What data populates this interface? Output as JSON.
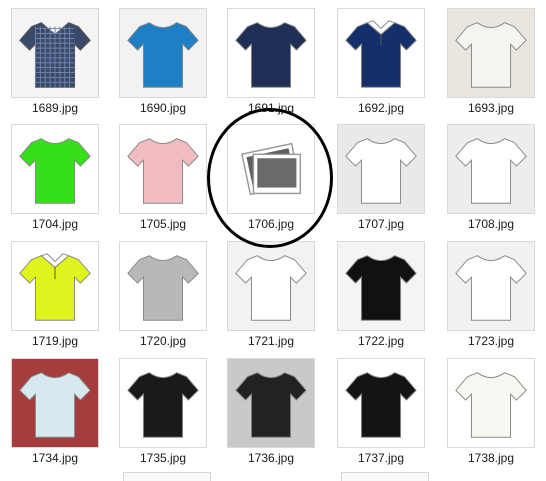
{
  "files": [
    {
      "label": "1689.jpg",
      "icon": "plaid-shirt-icon",
      "color": "#3b4a6b",
      "bg": "#f4f4f4"
    },
    {
      "label": "1690.jpg",
      "icon": "tshirt-icon",
      "color": "#1e7fc4",
      "bg": "#f2f2f2"
    },
    {
      "label": "1691.jpg",
      "icon": "tshirt-icon",
      "color": "#1f2f55",
      "bg": "#ffffff"
    },
    {
      "label": "1692.jpg",
      "icon": "polo-icon",
      "color": "#13306b",
      "bg": "#ffffff"
    },
    {
      "label": "1693.jpg",
      "icon": "tshirt-icon",
      "color": "#f5f5f0",
      "bg": "#e9e6df"
    },
    {
      "label": "1704.jpg",
      "icon": "tshirt-icon",
      "color": "#35e01a",
      "bg": "#ffffff"
    },
    {
      "label": "1705.jpg",
      "icon": "tshirt-icon",
      "color": "#f1bcc0",
      "bg": "#ffffff"
    },
    {
      "label": "1706.jpg",
      "icon": "image-placeholder-icon",
      "color": "#777777",
      "bg": "#ffffff"
    },
    {
      "label": "1707.jpg",
      "icon": "tshirt-icon",
      "color": "#ffffff",
      "bg": "#e9e9e9"
    },
    {
      "label": "1708.jpg",
      "icon": "tshirt-icon",
      "color": "#ffffff",
      "bg": "#ededed"
    },
    {
      "label": "1719.jpg",
      "icon": "polo-icon",
      "color": "#dff31c",
      "bg": "#ffffff"
    },
    {
      "label": "1720.jpg",
      "icon": "tshirt-icon",
      "color": "#b8b8b8",
      "bg": "#ffffff"
    },
    {
      "label": "1721.jpg",
      "icon": "tshirt-icon",
      "color": "#ffffff",
      "bg": "#f2f2f2"
    },
    {
      "label": "1722.jpg",
      "icon": "tshirt-icon",
      "color": "#111111",
      "bg": "#f4f4f4"
    },
    {
      "label": "1723.jpg",
      "icon": "tshirt-icon",
      "color": "#ffffff",
      "bg": "#f1f1f1"
    },
    {
      "label": "1734.jpg",
      "icon": "tshirt-icon",
      "color": "#d7e8ee",
      "bg": "#a63d3d"
    },
    {
      "label": "1735.jpg",
      "icon": "tshirt-icon",
      "color": "#1a1a1a",
      "bg": "#ffffff"
    },
    {
      "label": "1736.jpg",
      "icon": "tshirt-icon",
      "color": "#222222",
      "bg": "#c9c9c9"
    },
    {
      "label": "1737.jpg",
      "icon": "tshirt-icon",
      "color": "#141414",
      "bg": "#ffffff"
    },
    {
      "label": "1738.jpg",
      "icon": "tshirt-icon",
      "color": "#f7f7f2",
      "bg": "#ffffff"
    }
  ]
}
